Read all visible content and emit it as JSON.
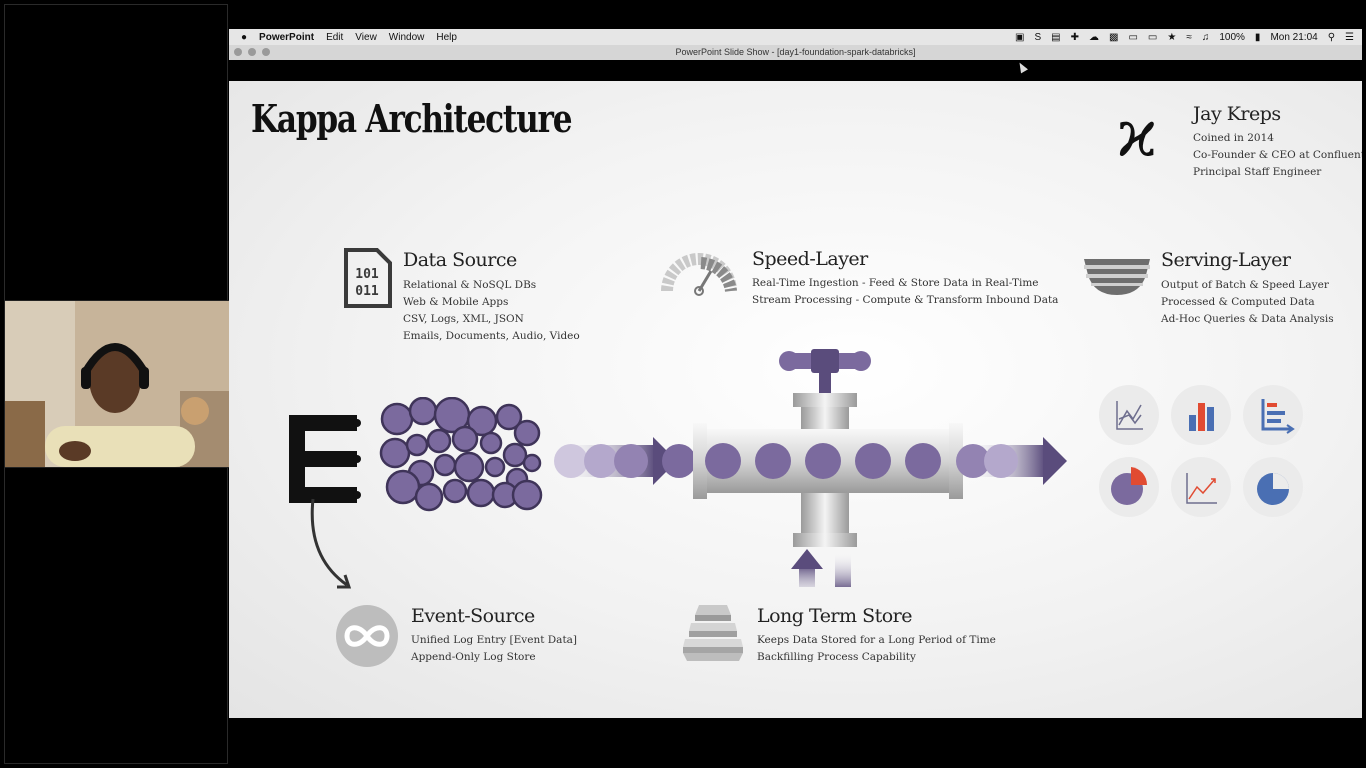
{
  "menubar": {
    "apple": "",
    "app_name": "PowerPoint",
    "items": [
      "Edit",
      "View",
      "Window",
      "Help"
    ],
    "battery": "100%",
    "clock": "Mon 21:04"
  },
  "window": {
    "title": "PowerPoint Slide Show - [day1-foundation-spark-databricks]"
  },
  "slide": {
    "title": "Kappa Architecture",
    "author": {
      "symbol": "ϰ",
      "name": "Jay Kreps",
      "lines": [
        "Coined in 2014",
        "Co-Founder & CEO at Confluent",
        "Principal Staff Engineer"
      ]
    },
    "data_source": {
      "title": "Data Source",
      "icon_text": [
        "101",
        "011"
      ],
      "lines": [
        "Relational & NoSQL DBs",
        "Web & Mobile Apps",
        "CSV, Logs, XML, JSON",
        "Emails, Documents, Audio, Video"
      ]
    },
    "speed_layer": {
      "title": "Speed-Layer",
      "lines": [
        "Real-Time Ingestion - Feed & Store Data in Real-Time",
        "Stream Processing - Compute & Transform Inbound Data"
      ]
    },
    "serving_layer": {
      "title": "Serving-Layer",
      "lines": [
        "Output of Batch & Speed Layer",
        "Processed & Computed Data",
        "Ad-Hoc Queries & Data Analysis"
      ]
    },
    "event_source": {
      "title": "Event-Source",
      "lines": [
        "Unified Log Entry [Event Data]",
        "Append-Only Log Store"
      ]
    },
    "long_term_store": {
      "title": "Long Term Store",
      "lines": [
        "Keeps Data Stored for a Long Period of Time",
        "Backfilling Process Capability"
      ]
    },
    "colors": {
      "accent": "#7b6a9e",
      "accent_dark": "#5a4c7c",
      "chart_blue": "#4a6fb3",
      "chart_red": "#e14b32"
    },
    "icons": [
      "event-hub-icon",
      "data-bubbles-icon",
      "stream-arrow-icon",
      "pipe-valve-icon",
      "storage-arrows-icon",
      "infinity-icon",
      "stack-icon",
      "gauge-icon",
      "bowl-icon",
      "file-binary-icon"
    ]
  }
}
